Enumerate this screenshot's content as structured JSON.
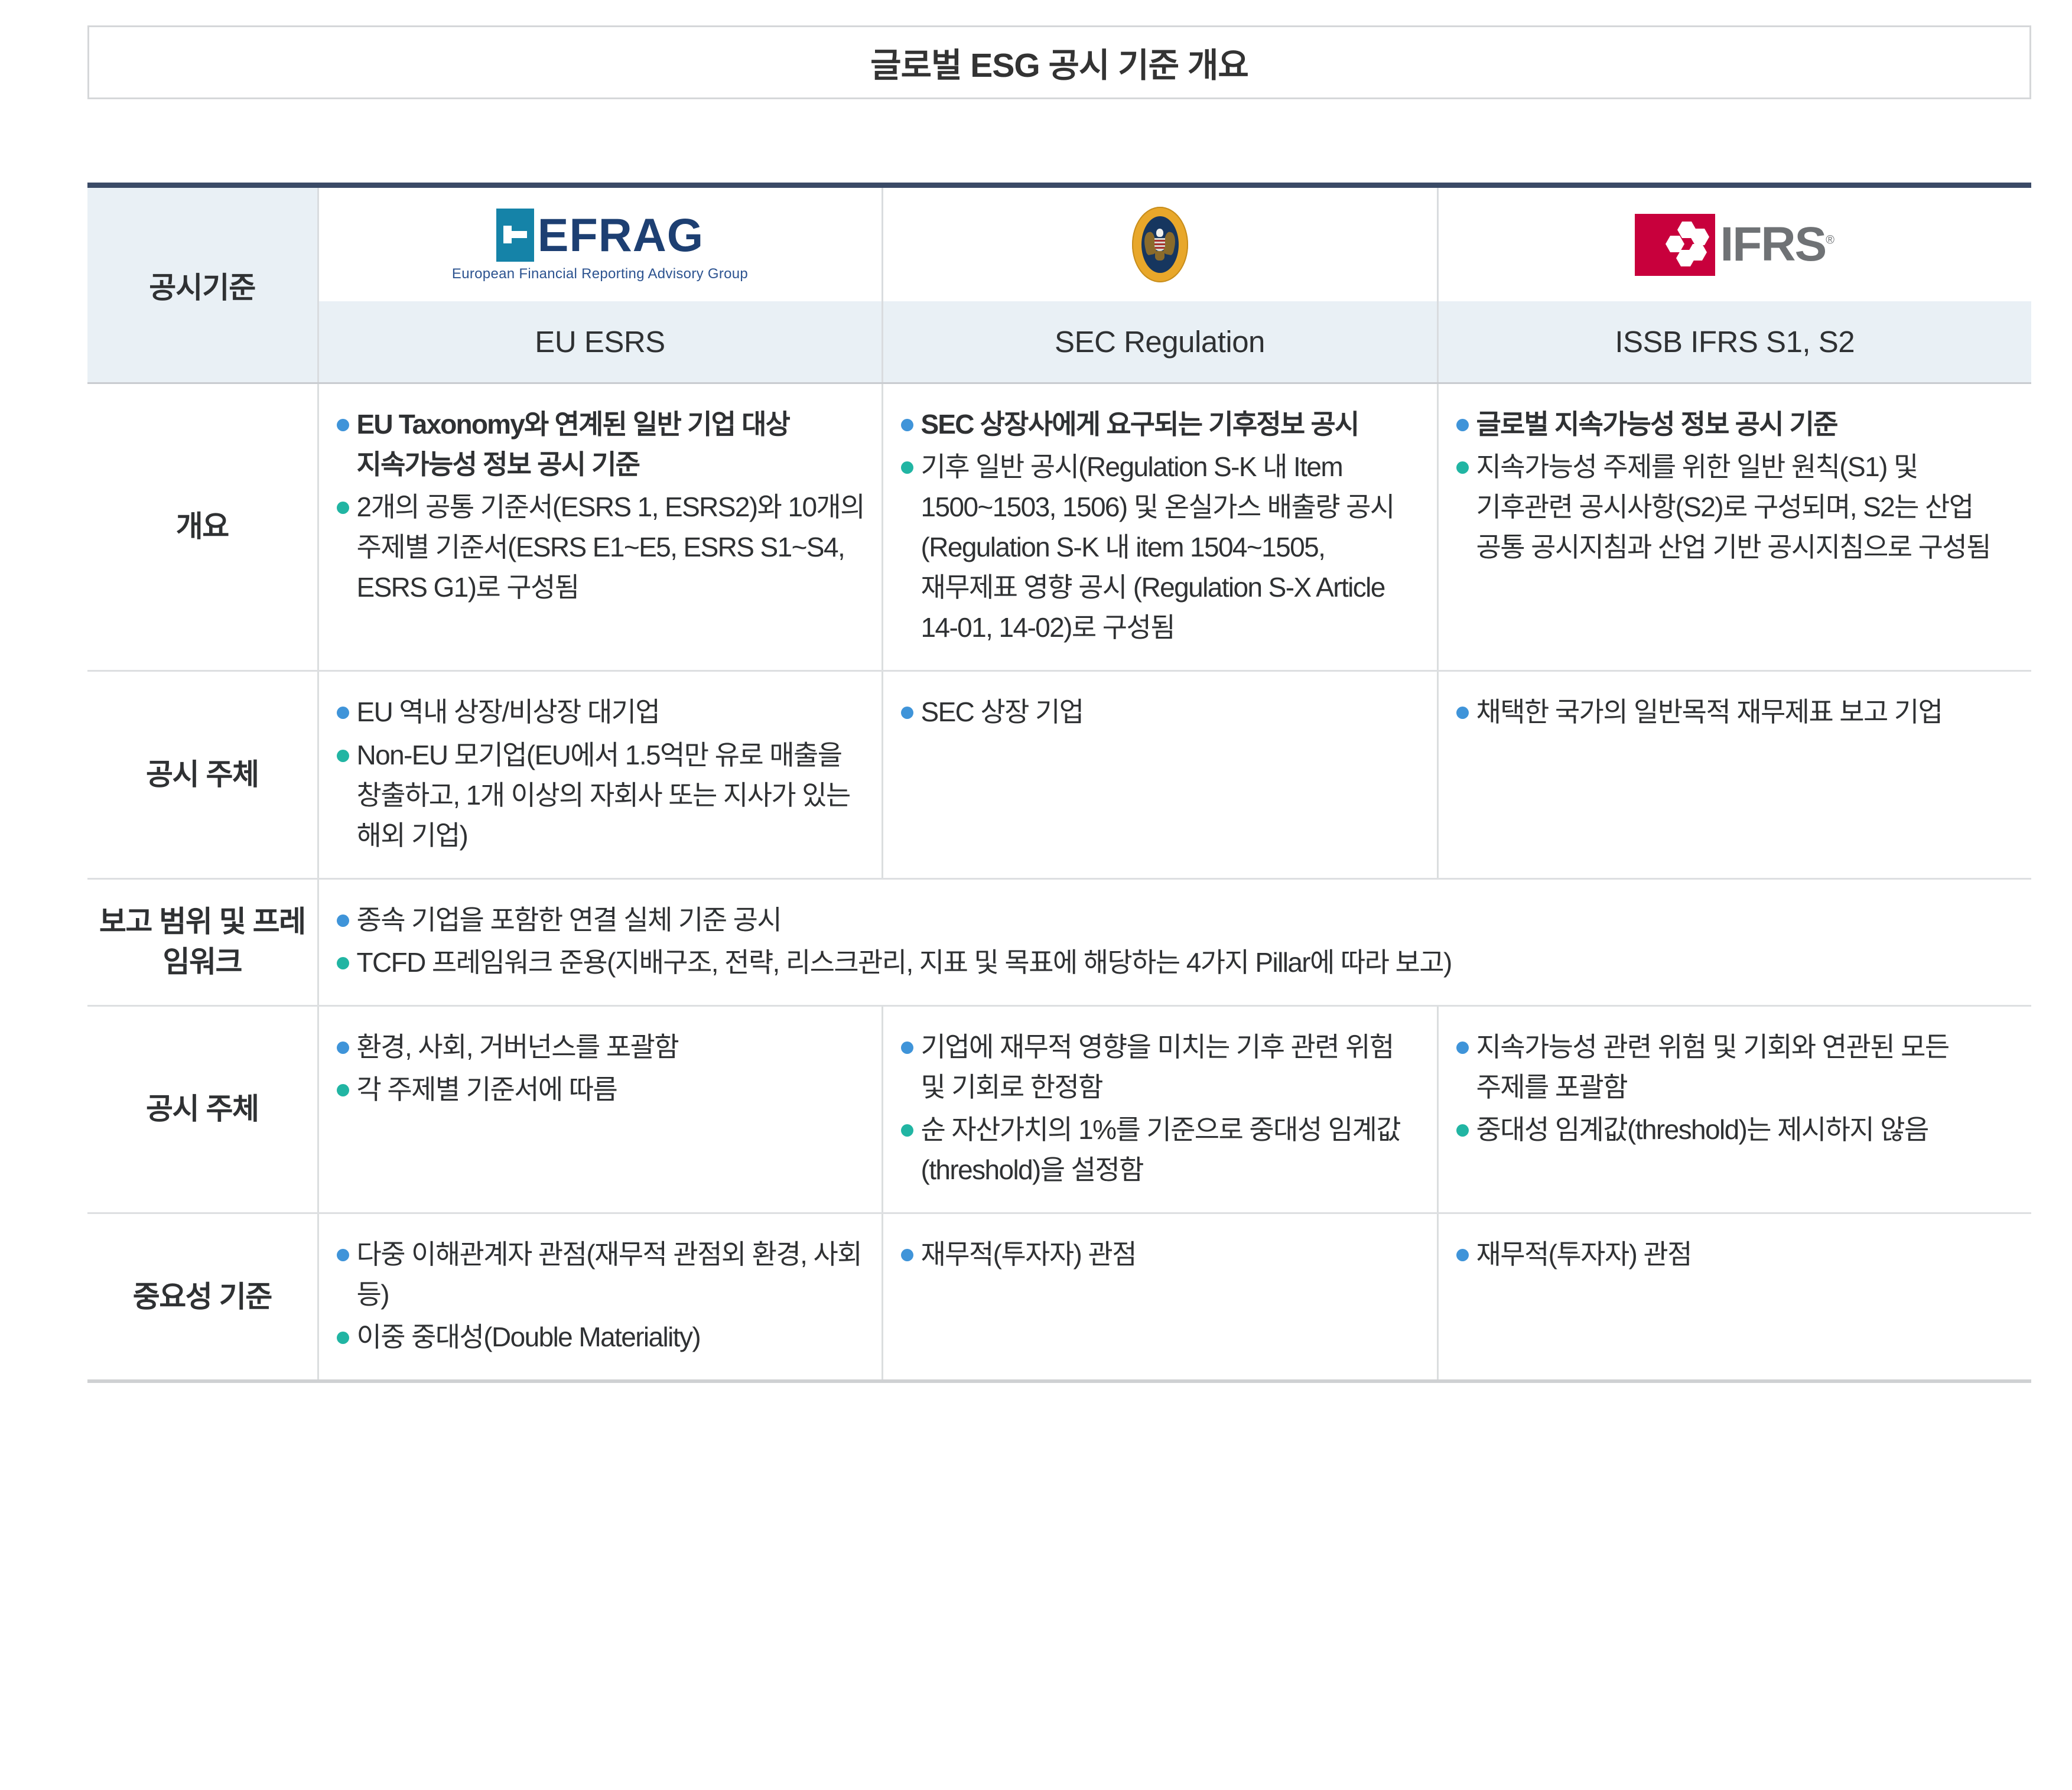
{
  "page": {
    "title": "글로벌 ESG 공시 기준 개요"
  },
  "table": {
    "corner_label": "공시기준",
    "columns": [
      {
        "id": "eu",
        "logo": "efrag-logo",
        "logo_word": "EFRAG",
        "logo_tagline": "European Financial Reporting Advisory Group",
        "name": "EU ESRS"
      },
      {
        "id": "sec",
        "logo": "sec-seal-icon",
        "name": "SEC Regulation"
      },
      {
        "id": "ifrs",
        "logo": "ifrs-logo",
        "logo_word": "IFRS",
        "logo_mark_symbol": "®",
        "name": "ISSB IFRS S1, S2"
      }
    ],
    "rows": [
      {
        "label": "개요",
        "merged": false,
        "cells": {
          "eu": [
            {
              "text": "EU Taxonomy와 연계된 일반 기업 대상 지속가능성 정보 공시 기준",
              "bold": true,
              "dot": "blue"
            },
            {
              "text": "2개의 공통 기준서(ESRS 1, ESRS2)와 10개의 주제별 기준서(ESRS E1~E5, ESRS S1~S4, ESRS G1)로 구성됨",
              "bold": false,
              "dot": "teal"
            }
          ],
          "sec": [
            {
              "text": "SEC 상장사에게 요구되는 기후정보 공시",
              "bold": true,
              "dot": "blue"
            },
            {
              "text": "기후 일반 공시(Regulation S-K 내 Item 1500~1503, 1506) 및 온실가스 배출량 공시(Regulation S-K 내 item 1504~1505, 재무제표 영향 공시 (Regulation S-X Article 14-01, 14-02)로 구성됨",
              "bold": false,
              "dot": "teal"
            }
          ],
          "ifrs": [
            {
              "text": "글로벌 지속가능성 정보 공시 기준",
              "bold": true,
              "dot": "blue"
            },
            {
              "text": "지속가능성 주제를 위한 일반 원칙(S1) 및 기후관련 공시사항(S2)로 구성되며, S2는 산업 공통 공시지침과 산업 기반 공시지침으로 구성됨",
              "bold": false,
              "dot": "teal"
            }
          ]
        }
      },
      {
        "label": "공시 주체",
        "merged": false,
        "cells": {
          "eu": [
            {
              "text": "EU 역내 상장/비상장 대기업",
              "bold": false,
              "dot": "blue"
            },
            {
              "text": "Non-EU 모기업(EU에서 1.5억만 유로 매출을 창출하고, 1개 이상의 자회사 또는 지사가 있는 해외 기업)",
              "bold": false,
              "dot": "teal"
            }
          ],
          "sec": [
            {
              "text": "SEC 상장 기업",
              "bold": false,
              "dot": "blue"
            }
          ],
          "ifrs": [
            {
              "text": "채택한 국가의 일반목적 재무제표 보고 기업",
              "bold": false,
              "dot": "blue"
            }
          ]
        }
      },
      {
        "label": "보고 범위 및 프레임워크",
        "merged": true,
        "cells": {
          "all": [
            {
              "text": "종속 기업을 포함한 연결 실체 기준 공시",
              "bold": false,
              "dot": "blue"
            },
            {
              "text": "TCFD 프레임워크 준용(지배구조, 전략, 리스크관리, 지표 및 목표에 해당하는 4가지 Pillar에 따라 보고)",
              "bold": false,
              "dot": "teal"
            }
          ]
        }
      },
      {
        "label": "공시 주체",
        "merged": false,
        "cells": {
          "eu": [
            {
              "text": "환경, 사회, 거버넌스를 포괄함",
              "bold": false,
              "dot": "blue"
            },
            {
              "text": "각 주제별 기준서에 따름",
              "bold": false,
              "dot": "teal"
            }
          ],
          "sec": [
            {
              "text": "기업에 재무적 영향을 미치는 기후 관련 위험 및 기회로 한정함",
              "bold": false,
              "dot": "blue"
            },
            {
              "text": "순 자산가치의 1%를 기준으로 중대성 임계값(threshold)을 설정함",
              "bold": false,
              "dot": "teal"
            }
          ],
          "ifrs": [
            {
              "text": "지속가능성 관련 위험 및 기회와 연관된 모든 주제를 포괄함",
              "bold": false,
              "dot": "blue"
            },
            {
              "text": "중대성 임계값(threshold)는 제시하지 않음",
              "bold": false,
              "dot": "teal"
            }
          ]
        }
      },
      {
        "label": "중요성 기준",
        "merged": false,
        "cells": {
          "eu": [
            {
              "text": "다중 이해관계자 관점(재무적 관점외 환경, 사회 등)",
              "bold": false,
              "dot": "blue"
            },
            {
              "text": "이중 중대성(Double Materiality)",
              "bold": false,
              "dot": "teal"
            }
          ],
          "sec": [
            {
              "text": "재무적(투자자) 관점",
              "bold": false,
              "dot": "blue"
            }
          ],
          "ifrs": [
            {
              "text": "재무적(투자자) 관점",
              "bold": false,
              "dot": "blue"
            }
          ]
        }
      }
    ]
  },
  "colors": {
    "header_rule": "#3a4a66",
    "header_bg": "#e9f0f5",
    "bullet_blue": "#3f94d9",
    "bullet_teal": "#21b5a3",
    "efrag_blue": "#1d3f72",
    "efrag_teal": "#1583a8",
    "ifrs_red": "#c8003c",
    "ifrs_grey": "#6f7275",
    "sec_gold": "#e8a72a",
    "sec_navy": "#16365f"
  }
}
